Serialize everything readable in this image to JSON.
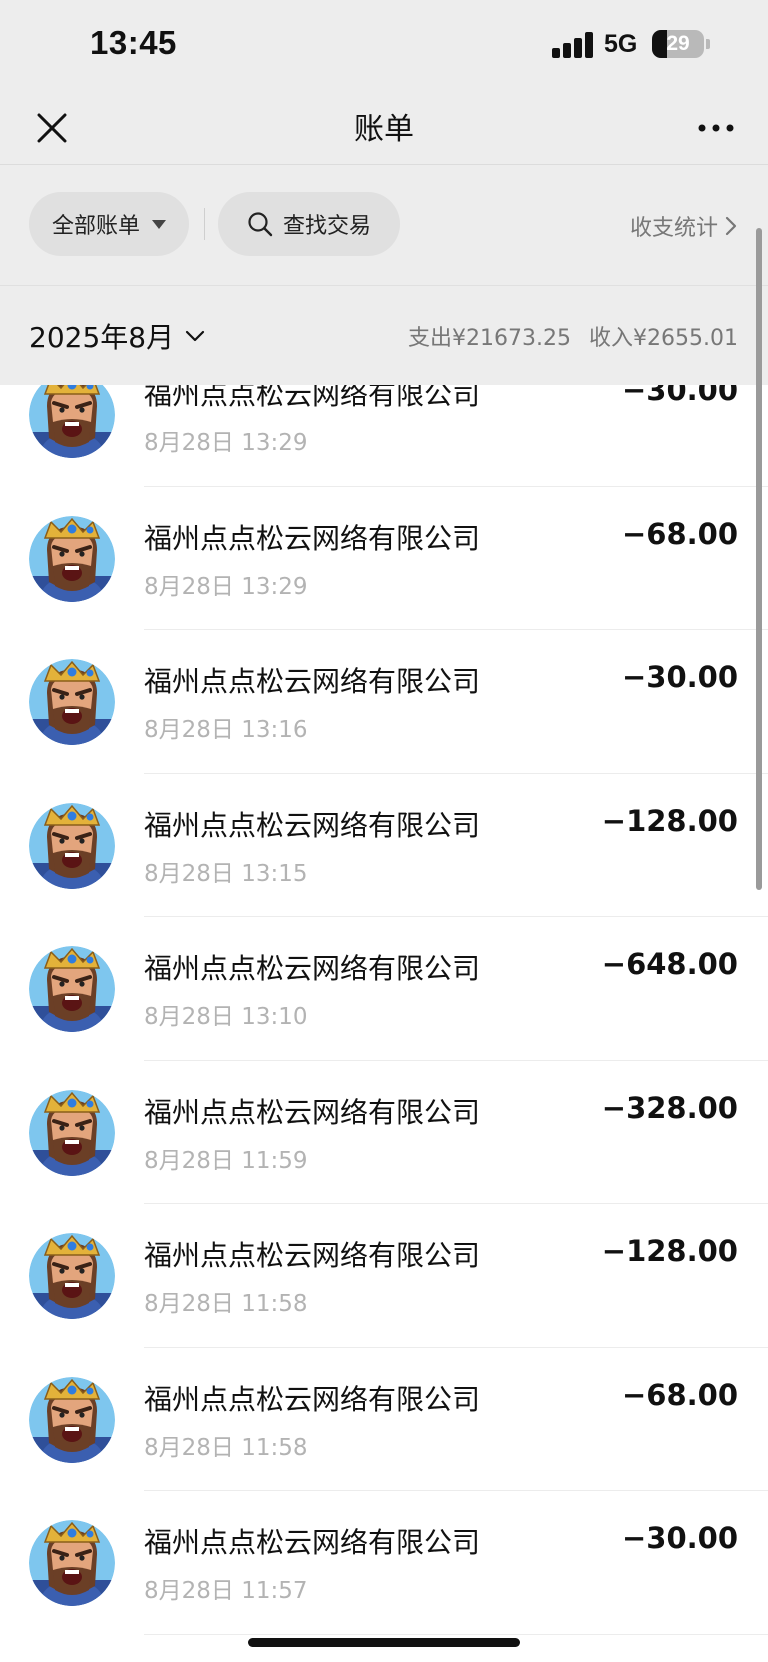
{
  "status_bar": {
    "time": "13:45",
    "network": "5G",
    "battery": "29",
    "battery_level": 0.29
  },
  "nav": {
    "title": "账单",
    "close_icon": "close-icon",
    "more_icon": "more-icon"
  },
  "filters": {
    "all_bills": "全部账单",
    "search": "查找交易",
    "stats": "收支统计"
  },
  "month": {
    "label": "2025年8月",
    "expense": "支出¥21673.25",
    "income": "收入¥2655.01"
  },
  "transactions": [
    {
      "name": "福州点点松云网络有限公司",
      "time": "8月28日 13:29",
      "amount": "−30.00"
    },
    {
      "name": "福州点点松云网络有限公司",
      "time": "8月28日 13:29",
      "amount": "−68.00"
    },
    {
      "name": "福州点点松云网络有限公司",
      "time": "8月28日 13:16",
      "amount": "−30.00"
    },
    {
      "name": "福州点点松云网络有限公司",
      "time": "8月28日 13:15",
      "amount": "−128.00"
    },
    {
      "name": "福州点点松云网络有限公司",
      "time": "8月28日 13:10",
      "amount": "−648.00"
    },
    {
      "name": "福州点点松云网络有限公司",
      "time": "8月28日 11:59",
      "amount": "−328.00"
    },
    {
      "name": "福州点点松云网络有限公司",
      "time": "8月28日 11:58",
      "amount": "−128.00"
    },
    {
      "name": "福州点点松云网络有限公司",
      "time": "8月28日 11:58",
      "amount": "−68.00"
    },
    {
      "name": "福州点点松云网络有限公司",
      "time": "8月28日 11:57",
      "amount": "−30.00"
    }
  ],
  "colors": {
    "header_bg": "#ededed",
    "pill_bg": "#e0e0e0",
    "secondary_text": "#777777",
    "time_text": "#b3b3b3"
  }
}
